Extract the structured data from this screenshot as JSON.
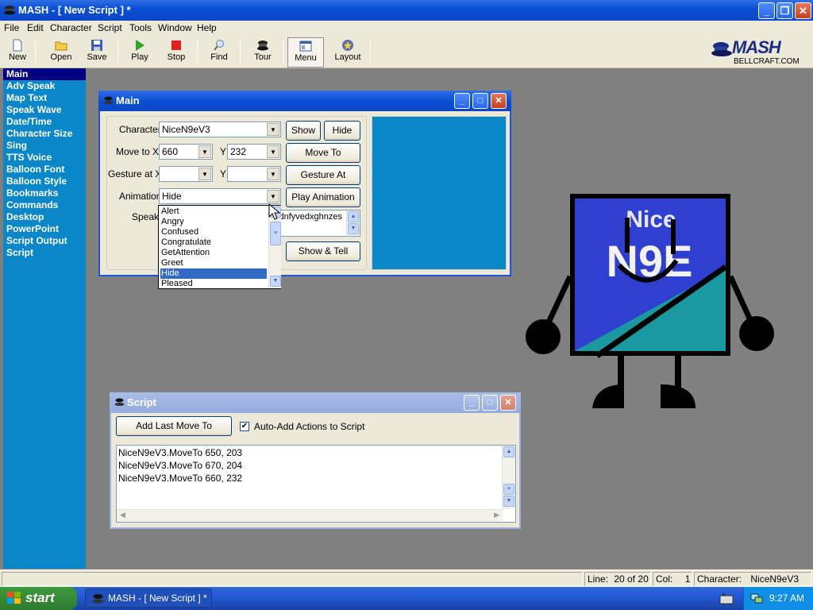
{
  "app": {
    "title": "MASH - [ New Script ] *"
  },
  "menubar": [
    "File",
    "Edit",
    "Character",
    "Script",
    "Tools",
    "Window",
    "Help"
  ],
  "toolbar": {
    "buttons": [
      {
        "label": "New",
        "icon": "new-document-icon"
      },
      {
        "label": "Open",
        "icon": "open-folder-icon"
      },
      {
        "label": "Save",
        "icon": "save-disk-icon"
      },
      {
        "label": "Play",
        "icon": "play-icon"
      },
      {
        "label": "Stop",
        "icon": "stop-icon"
      },
      {
        "label": "Find",
        "icon": "find-magnifier-icon"
      },
      {
        "label": "Tour",
        "icon": "tour-icon"
      },
      {
        "label": "Menu",
        "icon": "menu-window-icon"
      },
      {
        "label": "Layout",
        "icon": "layout-icon"
      }
    ],
    "brand_logo": "MASH",
    "brand_site": "BELLCRAFT.COM"
  },
  "sidebar": {
    "items": [
      "Main",
      "Adv Speak",
      "Map Text",
      "Speak Wave",
      "Date/Time",
      "Character Size",
      "Sing",
      "TTS Voice",
      "Balloon Font",
      "Balloon Style",
      "Bookmarks",
      "Commands",
      "Desktop",
      "PowerPoint",
      "Script Output",
      "Script"
    ],
    "active": "Main"
  },
  "main_window": {
    "title": "Main",
    "character_label": "Character",
    "character_value": "NiceN9eV3",
    "show_button": "Show",
    "hide_button": "Hide",
    "moveto_label": "Move to X",
    "moveto_x": "660",
    "moveto_y_label": "Y",
    "moveto_y": "232",
    "moveto_button": "Move To",
    "gesture_label": "Gesture at X",
    "gesture_y_label": "Y",
    "gesture_button": "Gesture At",
    "animation_label": "Animation",
    "animation_value": "Hide",
    "play_animation_button": "Play Animation",
    "speak_label": "Speak",
    "speak_text": "dnfyvedxghnzes",
    "show_tell_button": "Show & Tell",
    "animation_options": [
      "Alert",
      "Angry",
      "Confused",
      "Congratulate",
      "GetAttention",
      "Greet",
      "Hide",
      "Pleased"
    ],
    "animation_selected": "Hide",
    "preview_color": "#0a87c8"
  },
  "script_window": {
    "title": "Script",
    "add_last_button": "Add Last Move To",
    "auto_add_label": "Auto-Add Actions to Script",
    "auto_add_checked": true,
    "lines": [
      "NiceN9eV3.MoveTo 650, 203",
      "NiceN9eV3.MoveTo 670, 204",
      "NiceN9eV3.MoveTo 660, 232"
    ]
  },
  "character": {
    "text_top": "Nice",
    "text_bottom": "N9E",
    "body_color": "#2f3fd0",
    "accent_color": "#1a9aa0"
  },
  "statusbar": {
    "line_label": "Line:",
    "line_value": "20 of 20",
    "col_label": "Col:",
    "col_value": "1",
    "character_label": "Character:",
    "character_value": "NiceN9eV3"
  },
  "taskbar": {
    "start_label": "start",
    "task_label": "MASH - [ New Script ] *",
    "clock": "9:27 AM"
  },
  "colors": {
    "desktop": "#808080",
    "sidebar": "#0a87c8",
    "xp_blue": "#0a4fd6",
    "selection": "#316ac5"
  }
}
